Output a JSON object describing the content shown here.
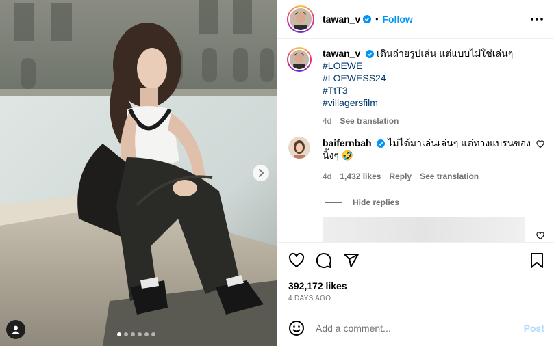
{
  "post": {
    "username": "tawan_v",
    "separator": "•",
    "follow_label": "Follow",
    "caption_text": "เดินถ่ายรูปเล่น แต่แบบไม่ใช่เล่นๆ",
    "hashtags": [
      "#LOEWE",
      "#LOEWESS24",
      "#TtT3",
      "#villagersfilm"
    ],
    "caption_age": "4d",
    "see_translation": "See translation",
    "photo_count": 6,
    "active_photo": 1
  },
  "reply": {
    "username": "baifernbah",
    "text": "ไม่ได้มาเล่นเล่นๆ แต่ทางแบรนของ นิ้งๆ 🤣",
    "age": "4d",
    "likes": "1,432 likes",
    "reply_label": "Reply",
    "see_translation": "See translation",
    "hide_replies": "Hide replies"
  },
  "footer": {
    "likes": "392,172 likes",
    "date": "4 DAYS AGO",
    "comment_placeholder": "Add a comment...",
    "post_label": "Post"
  },
  "icons": {
    "verified": "verified-badge-icon",
    "more": "more-options-icon",
    "like": "heart-icon",
    "comment": "comment-icon",
    "share": "share-icon",
    "save": "bookmark-icon",
    "emoji": "emoji-icon",
    "next": "chevron-right-icon",
    "tag": "user-tag-icon"
  },
  "colors": {
    "accent": "#0095f6",
    "hashtag": "#00376b",
    "verified": "#0095f6",
    "muted": "#737373"
  }
}
